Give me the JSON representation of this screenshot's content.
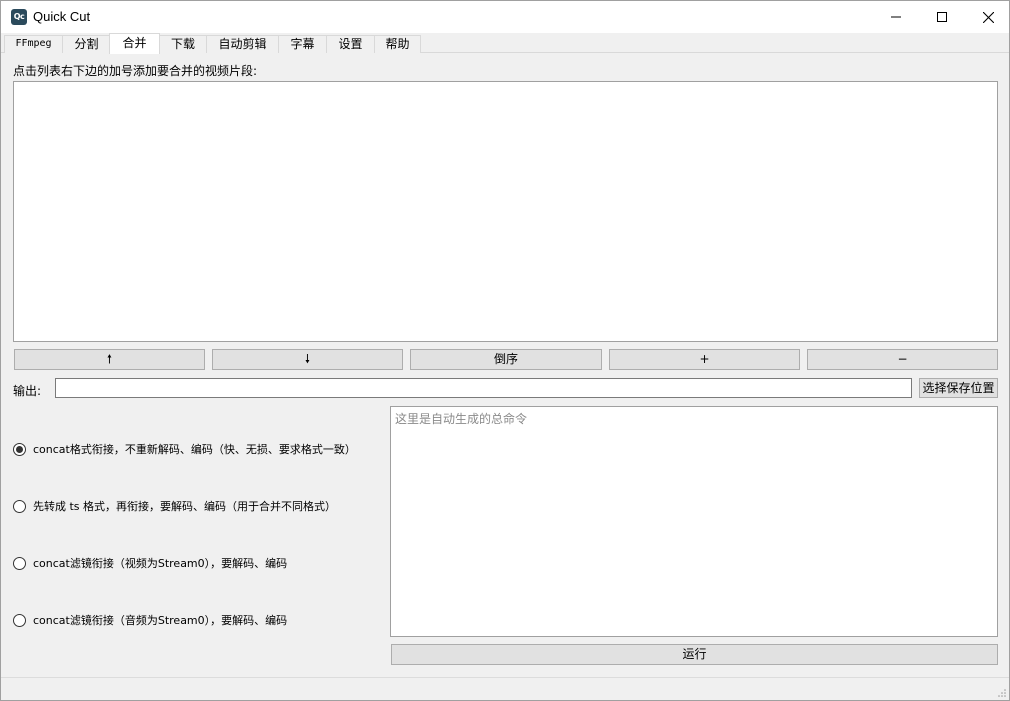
{
  "window": {
    "title": "Quick Cut",
    "icon_text": "Qc"
  },
  "tabs": [
    {
      "label": "FFmpeg",
      "active": false
    },
    {
      "label": "分割",
      "active": false
    },
    {
      "label": "合并",
      "active": true
    },
    {
      "label": "下载",
      "active": false
    },
    {
      "label": "自动剪辑",
      "active": false
    },
    {
      "label": "字幕",
      "active": false
    },
    {
      "label": "设置",
      "active": false
    },
    {
      "label": "帮助",
      "active": false
    }
  ],
  "merge": {
    "instruction": "点击列表右下边的加号添加要合并的视频片段:",
    "buttons": {
      "move_up": "🠕",
      "move_down": "🠗",
      "reverse": "倒序",
      "add": "+",
      "remove": "−"
    },
    "output_label": "输出:",
    "output_value": "",
    "choose_location": "选择保存位置",
    "options": [
      {
        "label": "concat格式衔接，不重新解码、编码（快、无损、要求格式一致）",
        "checked": true
      },
      {
        "label": "先转成 ts 格式，再衔接，要解码、编码（用于合并不同格式）",
        "checked": false
      },
      {
        "label": "concat滤镜衔接（视频为Stream0），要解码、编码",
        "checked": false
      },
      {
        "label": "concat滤镜衔接（音频为Stream0），要解码、编码",
        "checked": false
      }
    ],
    "command_placeholder": "这里是自动生成的总命令",
    "run_button": "运行"
  },
  "colors": {
    "window_bg": "#f0f0f0",
    "button_bg": "#e1e1e1",
    "button_border": "#adadad",
    "app_icon": "#2b4a5c"
  }
}
